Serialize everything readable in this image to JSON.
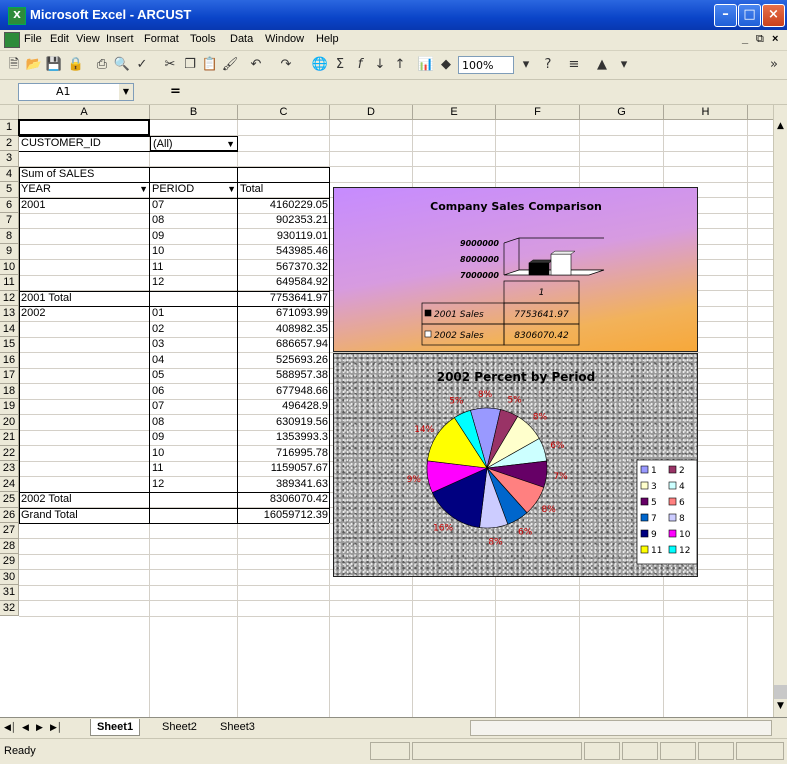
{
  "window": {
    "title": "Microsoft Excel - ARCUST",
    "app_icon": "excel-icon"
  },
  "menu": [
    "File",
    "Edit",
    "View",
    "Insert",
    "Format",
    "Tools",
    "Data",
    "Window",
    "Help"
  ],
  "toolbar": {
    "zoom": "100%"
  },
  "formula_bar": {
    "cell_ref": "A1",
    "equals": "="
  },
  "columns": [
    "A",
    "B",
    "C",
    "D",
    "E",
    "F",
    "G",
    "H"
  ],
  "rows": [
    "1",
    "2",
    "3",
    "4",
    "5",
    "6",
    "7",
    "8",
    "9",
    "10",
    "11",
    "12",
    "13",
    "14",
    "15",
    "16",
    "17",
    "18",
    "19",
    "20",
    "21",
    "22",
    "23",
    "24",
    "25",
    "26",
    "27",
    "28",
    "29",
    "30",
    "31",
    "32"
  ],
  "pivot": {
    "filter_label": "CUSTOMER_ID",
    "filter_value": "(All)",
    "data_label": "Sum of SALES",
    "year_header": "YEAR",
    "period_header": "PERIOD",
    "total_header": "Total",
    "rows": [
      {
        "year": "2001",
        "period": "07",
        "total": "4160229.05"
      },
      {
        "year": "",
        "period": "08",
        "total": "902353.21"
      },
      {
        "year": "",
        "period": "09",
        "total": "930119.01"
      },
      {
        "year": "",
        "period": "10",
        "total": "543985.46"
      },
      {
        "year": "",
        "period": "11",
        "total": "567370.32"
      },
      {
        "year": "",
        "period": "12",
        "total": "649584.92"
      },
      {
        "year": "2001 Total",
        "period": "",
        "total": "7753641.97"
      },
      {
        "year": "2002",
        "period": "01",
        "total": "671093.99"
      },
      {
        "year": "",
        "period": "02",
        "total": "408982.35"
      },
      {
        "year": "",
        "period": "03",
        "total": "686657.94"
      },
      {
        "year": "",
        "period": "04",
        "total": "525693.26"
      },
      {
        "year": "",
        "period": "05",
        "total": "588957.38"
      },
      {
        "year": "",
        "period": "06",
        "total": "677948.66"
      },
      {
        "year": "",
        "period": "07",
        "total": "496428.9"
      },
      {
        "year": "",
        "period": "08",
        "total": "630919.56"
      },
      {
        "year": "",
        "period": "09",
        "total": "1353993.3"
      },
      {
        "year": "",
        "period": "10",
        "total": "716995.78"
      },
      {
        "year": "",
        "period": "11",
        "total": "1159057.67"
      },
      {
        "year": "",
        "period": "12",
        "total": "389341.63"
      },
      {
        "year": "2002 Total",
        "period": "",
        "total": "8306070.42"
      },
      {
        "year": "Grand Total",
        "period": "",
        "total": "16059712.39"
      }
    ]
  },
  "sheets": [
    "Sheet1",
    "Sheet2",
    "Sheet3"
  ],
  "status": "Ready",
  "chart_data": [
    {
      "type": "bar",
      "title": "Company Sales Comparison",
      "categories": [
        "1"
      ],
      "y_ticks": [
        "9000000",
        "8000000",
        "7000000"
      ],
      "ylim": [
        7000000,
        9000000
      ],
      "series": [
        {
          "name": "2001 Sales",
          "values": [
            7753641.97
          ],
          "label": "7753641.97",
          "color": "#000000"
        },
        {
          "name": "2002 Sales",
          "values": [
            8306070.42
          ],
          "label": "8306070.42",
          "color": "#ffffff"
        }
      ]
    },
    {
      "type": "pie",
      "title": "2002 Percent by Period",
      "labels": [
        "1",
        "2",
        "3",
        "4",
        "5",
        "6",
        "7",
        "8",
        "9",
        "10",
        "11",
        "12"
      ],
      "values": [
        671093.99,
        408982.35,
        686657.94,
        525693.26,
        588957.38,
        677948.66,
        496428.9,
        630919.56,
        1353993.3,
        716995.78,
        1159057.67,
        389341.63
      ],
      "percent_labels": [
        "8%",
        "5%",
        "8%",
        "6%",
        "7%",
        "8%",
        "6%",
        "8%",
        "16%",
        "9%",
        "14%",
        "5%"
      ],
      "colors": [
        "#9999ff",
        "#993366",
        "#ffffcc",
        "#ccffff",
        "#660066",
        "#ff8080",
        "#0066cc",
        "#ccccff",
        "#000080",
        "#ff00ff",
        "#ffff00",
        "#00ffff"
      ]
    }
  ]
}
